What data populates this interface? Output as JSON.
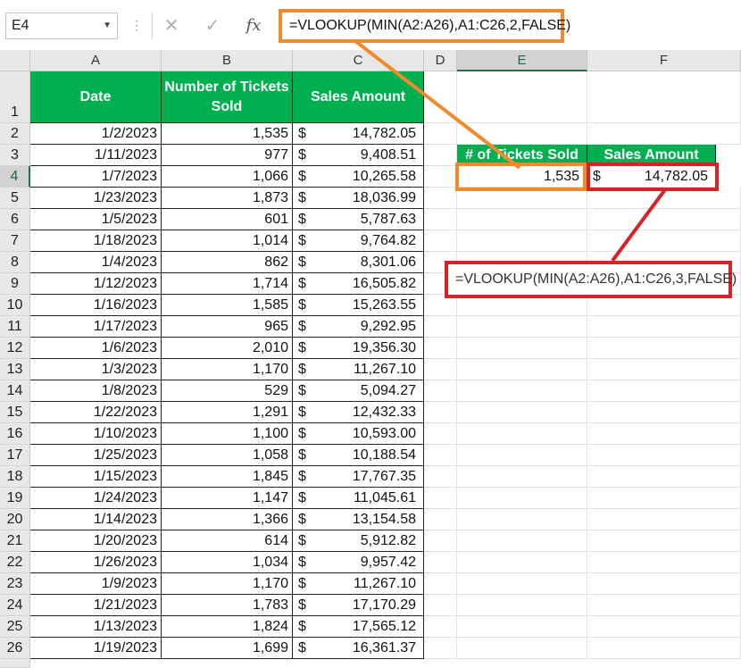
{
  "formula_bar": {
    "name_box": "E4",
    "cancel_glyph": "✕",
    "enter_glyph": "✓",
    "fx_label": "fx",
    "formula": "=VLOOKUP(MIN(A2:A26),A1:C26,2,FALSE)"
  },
  "columns": [
    "A",
    "B",
    "C",
    "D",
    "E",
    "F"
  ],
  "selected_column": "E",
  "selected_row": "4",
  "table": {
    "headers": [
      "Date",
      "Number of Tickets Sold",
      "Sales Amount"
    ],
    "currency_symbol": "$",
    "rows": [
      {
        "row": "2",
        "date": "1/2/2023",
        "tickets": "1,535",
        "amount": "14,782.05"
      },
      {
        "row": "3",
        "date": "1/11/2023",
        "tickets": "977",
        "amount": "9,408.51"
      },
      {
        "row": "4",
        "date": "1/7/2023",
        "tickets": "1,066",
        "amount": "10,265.58"
      },
      {
        "row": "5",
        "date": "1/23/2023",
        "tickets": "1,873",
        "amount": "18,036.99"
      },
      {
        "row": "6",
        "date": "1/5/2023",
        "tickets": "601",
        "amount": "5,787.63"
      },
      {
        "row": "7",
        "date": "1/18/2023",
        "tickets": "1,014",
        "amount": "9,764.82"
      },
      {
        "row": "8",
        "date": "1/4/2023",
        "tickets": "862",
        "amount": "8,301.06"
      },
      {
        "row": "9",
        "date": "1/12/2023",
        "tickets": "1,714",
        "amount": "16,505.82"
      },
      {
        "row": "10",
        "date": "1/16/2023",
        "tickets": "1,585",
        "amount": "15,263.55"
      },
      {
        "row": "11",
        "date": "1/17/2023",
        "tickets": "965",
        "amount": "9,292.95"
      },
      {
        "row": "12",
        "date": "1/6/2023",
        "tickets": "2,010",
        "amount": "19,356.30"
      },
      {
        "row": "13",
        "date": "1/3/2023",
        "tickets": "1,170",
        "amount": "11,267.10"
      },
      {
        "row": "14",
        "date": "1/8/2023",
        "tickets": "529",
        "amount": "5,094.27"
      },
      {
        "row": "15",
        "date": "1/22/2023",
        "tickets": "1,291",
        "amount": "12,432.33"
      },
      {
        "row": "16",
        "date": "1/10/2023",
        "tickets": "1,100",
        "amount": "10,593.00"
      },
      {
        "row": "17",
        "date": "1/25/2023",
        "tickets": "1,058",
        "amount": "10,188.54"
      },
      {
        "row": "18",
        "date": "1/15/2023",
        "tickets": "1,845",
        "amount": "17,767.35"
      },
      {
        "row": "19",
        "date": "1/24/2023",
        "tickets": "1,147",
        "amount": "11,045.61"
      },
      {
        "row": "20",
        "date": "1/14/2023",
        "tickets": "1,366",
        "amount": "13,154.58"
      },
      {
        "row": "21",
        "date": "1/20/2023",
        "tickets": "614",
        "amount": "5,912.82"
      },
      {
        "row": "22",
        "date": "1/26/2023",
        "tickets": "1,034",
        "amount": "9,957.42"
      },
      {
        "row": "23",
        "date": "1/9/2023",
        "tickets": "1,170",
        "amount": "11,267.10"
      },
      {
        "row": "24",
        "date": "1/21/2023",
        "tickets": "1,783",
        "amount": "17,170.29"
      },
      {
        "row": "25",
        "date": "1/13/2023",
        "tickets": "1,824",
        "amount": "17,565.12"
      },
      {
        "row": "26",
        "date": "1/19/2023",
        "tickets": "1,699",
        "amount": "16,361.37"
      }
    ]
  },
  "lookup": {
    "headers": [
      "# of Tickets Sold",
      "Sales Amount"
    ],
    "tickets_result": "1,535",
    "amount_currency": "$",
    "amount_result": "14,782.05",
    "amount_formula": "=VLOOKUP(MIN(A2:A26),A1:C26,3,FALSE)"
  },
  "colors": {
    "header_green": "#00b050",
    "orange_highlight": "#f08a2d",
    "red_highlight": "#d42428"
  }
}
